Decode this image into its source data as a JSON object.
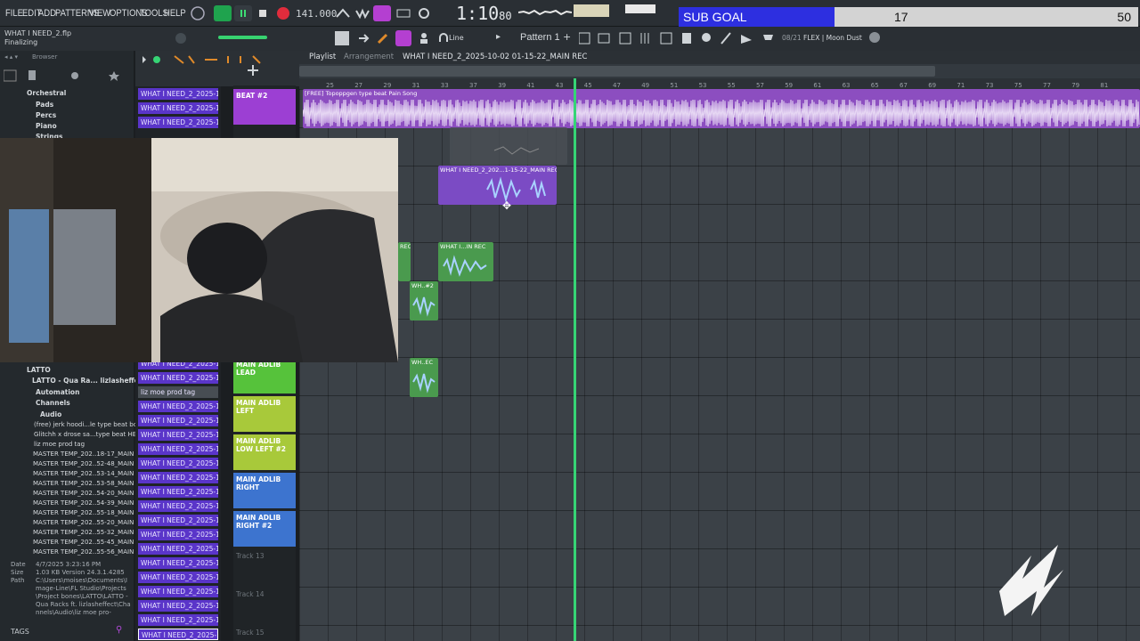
{
  "menu": {
    "file": "FILE",
    "edit": "EDIT",
    "add": "ADD",
    "patterns": "PATTERNS",
    "view": "VIEW",
    "options": "OPTIONS",
    "tools": "TOOLS",
    "help": "HELP"
  },
  "transport": {
    "bpm": "141.000",
    "time": "1:10",
    "time_frac": "80",
    "line_mode": "Line",
    "pattern": "Pattern 1",
    "counter": "08/21",
    "plugin": "FLEX | Moon Dust"
  },
  "subgoal": {
    "label": "SUB GOAL",
    "current": "17",
    "target": "50",
    "progress": 0.34
  },
  "status": {
    "file": "WHAT I NEED_2.flp",
    "state": "Finalizing"
  },
  "browser": {
    "title": "Browser",
    "items_top": [
      "Orchestral",
      "Pads",
      "Percs",
      "Piano",
      "Strings"
    ],
    "tree": [
      "LATTO",
      "LATTO - Qua Ra... lizlasheffect",
      "Automation",
      "Channels",
      "Audio"
    ],
    "files": [
      "(free) jerk hoodi...le type beat bound",
      "Glitchh x drose sa...type beat HELP ME",
      "liz moe prod tag",
      "MASTER TEMP_202..18-17_MAIN REC",
      "MASTER TEMP_202..52-48_MAIN REC",
      "MASTER TEMP_202..53-14_MAIN REC",
      "MASTER TEMP_202..53-58_MAIN REC",
      "MASTER TEMP_202..54-20_MAIN REC",
      "MASTER TEMP_202..54-39_MAIN REC",
      "MASTER TEMP_202..55-18_MAIN REC",
      "MASTER TEMP_202..55-20_MAIN REC",
      "MASTER TEMP_202..55-32_MAIN REC",
      "MASTER TEMP_202..55-45_MAIN REC",
      "MASTER TEMP_202..55-56_MAIN REC"
    ],
    "info": {
      "date_k": "Date",
      "date_v": "4/7/2025 3:23:16 PM",
      "size_k": "Size",
      "size_v": "1.03 KB",
      "version_k": "Version",
      "version_v": "24.3.1.4285",
      "path_k": "Path",
      "path_v": "C:\\Users\\moises\\Documents\\Image-Line\\FL Studio\\Projects\\Project bones\\LATTO\\LATTO - Qua Racks ft. lizlasheffect\\Channels\\Audio\\liz moe pro-"
    },
    "tags": "TAGS"
  },
  "playlist": {
    "title": "Playlist",
    "sub": "Arrangement",
    "project": "WHAT I NEED_2_2025-10-02 01-15-22_MAIN REC"
  },
  "ruler": [
    "25",
    "27",
    "29",
    "31",
    "33",
    "37",
    "39",
    "41",
    "43",
    "45",
    "47",
    "49",
    "51",
    "53",
    "55",
    "57",
    "59",
    "61",
    "63",
    "65",
    "67",
    "69",
    "71",
    "73",
    "75",
    "77",
    "79",
    "81"
  ],
  "channels": [
    "WHAT I NEED_2_2025-10...",
    "WHAT I NEED_2_2025-10...",
    "WHAT I NEED_2_2025-10...",
    "liz moe prod tag"
  ],
  "channel_name": "WHAT I NEED_2_2025-10...",
  "tracks": [
    {
      "name": "BEAT #2",
      "color": "#9c3fd3"
    },
    {
      "name": "MAIN ADLIB LEAD",
      "color": "#56c23b"
    },
    {
      "name": "MAIN ADLIB LEFT",
      "color": "#a8c93a"
    },
    {
      "name": "MAIN ADLIB LOW LEFT #2",
      "color": "#a8c93a"
    },
    {
      "name": "MAIN ADLIB RIGHT",
      "color": "#3d74cf"
    },
    {
      "name": "MAIN ADLIB RIGHT #2",
      "color": "#3d74cf"
    },
    {
      "name": "Track 13",
      "color": ""
    },
    {
      "name": "Track 14",
      "color": ""
    },
    {
      "name": "Track 15",
      "color": ""
    }
  ],
  "clips": {
    "beat": "[FREE] Topoppgen type beat  Pain Song",
    "c1": "WHAT I NEED_2_202...1-15-22_MAIN REC",
    "c2": "WHAT I NEED_2_202...1-15-22_MAIN REC",
    "c3": "WHAT I...IN REC",
    "c4": "WH..#2",
    "c5": "WH..EC",
    "c6": "REC"
  }
}
